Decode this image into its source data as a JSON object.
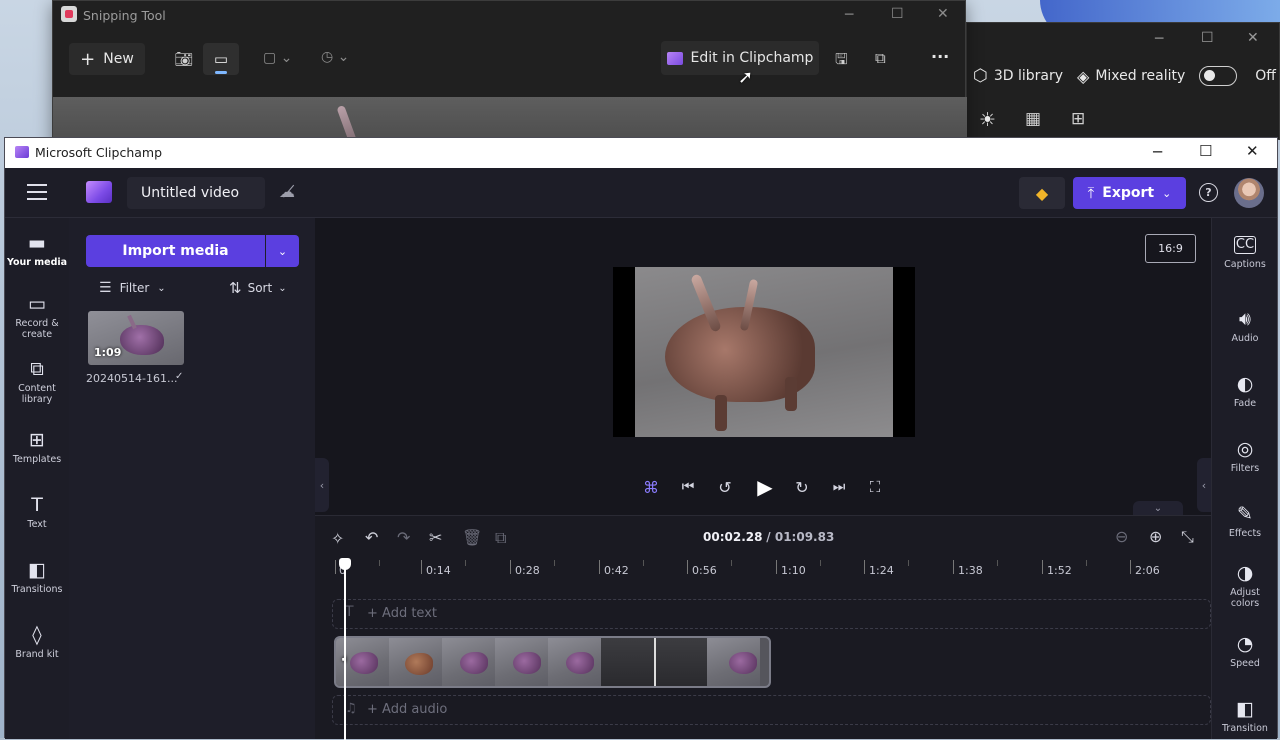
{
  "snipping_tool": {
    "title": "Snipping Tool",
    "new_label": "New",
    "edit_in_clipchamp_label": "Edit in Clipchamp",
    "more_label": "···"
  },
  "viewer_3d": {
    "library_label": "3D library",
    "mixed_reality_label": "Mixed reality",
    "toggle_state": "Off"
  },
  "clipchamp": {
    "window_title": "Microsoft Clipchamp",
    "project_title": "Untitled video",
    "export_label": "Export",
    "help_label": "?",
    "rail": [
      {
        "label": "Your media",
        "icon": "folder-icon"
      },
      {
        "label": "Record & create",
        "icon": "camera-icon"
      },
      {
        "label": "Content library",
        "icon": "content-library-icon"
      },
      {
        "label": "Templates",
        "icon": "templates-icon"
      },
      {
        "label": "Text",
        "icon": "text-icon"
      },
      {
        "label": "Transitions",
        "icon": "transitions-icon"
      },
      {
        "label": "Brand kit",
        "icon": "brand-kit-icon"
      }
    ],
    "media": {
      "import_label": "Import media",
      "filter_label": "Filter",
      "sort_label": "Sort",
      "item": {
        "duration": "1:09",
        "name": "20240514-161..."
      }
    },
    "preview": {
      "aspect_ratio": "16:9"
    },
    "right_panel": [
      {
        "label": "Captions",
        "icon": "captions-icon"
      },
      {
        "label": "Audio",
        "icon": "audio-icon"
      },
      {
        "label": "Fade",
        "icon": "fade-icon"
      },
      {
        "label": "Filters",
        "icon": "filters-icon"
      },
      {
        "label": "Effects",
        "icon": "effects-icon"
      },
      {
        "label": "Adjust colors",
        "icon": "adjust-colors-icon"
      },
      {
        "label": "Speed",
        "icon": "speed-icon"
      },
      {
        "label": "Transition",
        "icon": "transition-icon"
      }
    ],
    "timeline": {
      "current_time": "00:02.28",
      "total_time": "/ 01:09.83",
      "ticks": [
        "0",
        "0:14",
        "0:28",
        "0:42",
        "0:56",
        "1:10",
        "1:24",
        "1:38",
        "1:52",
        "2:06"
      ],
      "add_text_label": "+ Add text",
      "add_audio_label": "+ Add audio"
    },
    "colors": {
      "accent": "#5b3fe0",
      "accent_dark": "#4a32c0",
      "premium": "#f0b429"
    }
  }
}
